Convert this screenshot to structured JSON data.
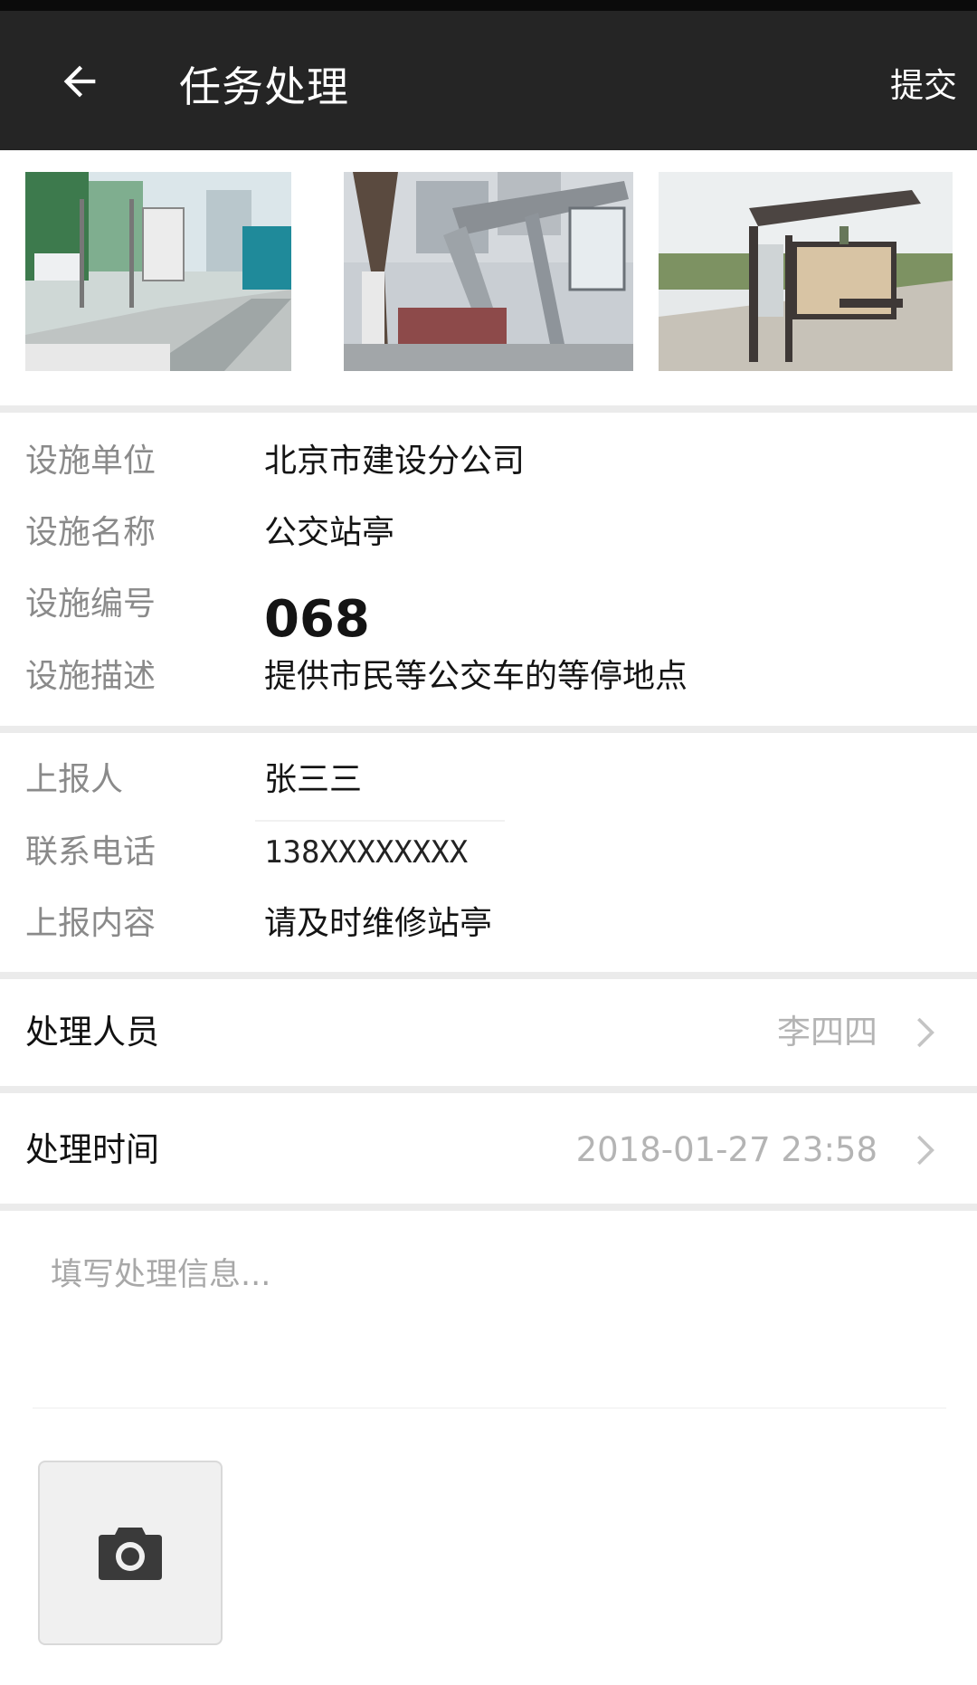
{
  "appbar": {
    "title": "任务处理",
    "submit_label": "提交",
    "back_icon": "arrow-left-icon"
  },
  "photos": [
    {
      "name": "bus-stop-photo-1"
    },
    {
      "name": "bus-stop-photo-2"
    },
    {
      "name": "bus-stop-photo-3"
    }
  ],
  "facility": {
    "unit_label": "设施单位",
    "unit_value": "北京市建设分公司",
    "name_label": "设施名称",
    "name_value": "公交站亭",
    "code_label": "设施编号",
    "code_value": "068",
    "desc_label": "设施描述",
    "desc_value": "提供市民等公交车的等停地点"
  },
  "report": {
    "reporter_label": "上报人",
    "reporter_value": "张三三",
    "phone_label": "联系电话",
    "phone_value": "138XXXXXXXX",
    "content_label": "上报内容",
    "content_value": "请及时维修站亭"
  },
  "handler": {
    "label": "处理人员",
    "value": "李四四"
  },
  "handle_time": {
    "label": "处理时间",
    "value": "2018-01-27 23:58"
  },
  "note": {
    "placeholder": "填写处理信息...",
    "value": ""
  },
  "camera": {
    "icon": "camera-icon"
  },
  "colors": {
    "appbar_bg": "#252525",
    "label_gray": "#8a8a8a",
    "value_gray": "#b4b4b4",
    "divider": "#ebebeb"
  }
}
